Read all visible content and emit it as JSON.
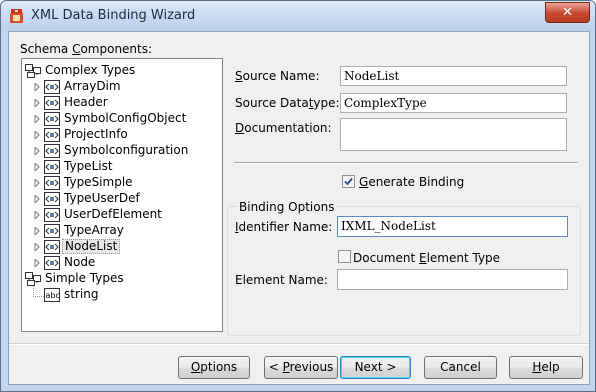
{
  "window": {
    "title": "XML Data Binding Wizard",
    "close_glyph": "✕"
  },
  "schema": {
    "label_pre": "Schema ",
    "label_mnemonic": "C",
    "label_post": "omponents:",
    "tree": [
      {
        "label": "Complex Types",
        "icon": "complex-types-folder-icon",
        "level": 0,
        "expander": false
      },
      {
        "label": "ArrayDim",
        "icon": "complex-type-icon",
        "level": 1,
        "expander": true
      },
      {
        "label": "Header",
        "icon": "complex-type-icon",
        "level": 1,
        "expander": true
      },
      {
        "label": "SymbolConfigObject",
        "icon": "complex-type-icon",
        "level": 1,
        "expander": true
      },
      {
        "label": "ProjectInfo",
        "icon": "complex-type-icon",
        "level": 1,
        "expander": true
      },
      {
        "label": "Symbolconfiguration",
        "icon": "complex-type-icon",
        "level": 1,
        "expander": true
      },
      {
        "label": "TypeList",
        "icon": "complex-type-icon",
        "level": 1,
        "expander": true
      },
      {
        "label": "TypeSimple",
        "icon": "complex-type-icon",
        "level": 1,
        "expander": true
      },
      {
        "label": "TypeUserDef",
        "icon": "complex-type-icon",
        "level": 1,
        "expander": true
      },
      {
        "label": "UserDefElement",
        "icon": "complex-type-icon",
        "level": 1,
        "expander": true
      },
      {
        "label": "TypeArray",
        "icon": "complex-type-icon",
        "level": 1,
        "expander": true
      },
      {
        "label": "NodeList",
        "icon": "complex-type-icon",
        "level": 1,
        "expander": true,
        "selected": true
      },
      {
        "label": "Node",
        "icon": "complex-type-icon",
        "level": 1,
        "expander": true
      },
      {
        "label": "Simple Types",
        "icon": "simple-types-folder-icon",
        "level": 0,
        "expander": false
      },
      {
        "label": "string",
        "icon": "abc-simple-type-icon",
        "level": 1,
        "expander": false,
        "abc": "abc"
      }
    ]
  },
  "details": {
    "source_name_label": {
      "pre": "",
      "m": "S",
      "post": "ource Name:"
    },
    "source_name_value": "NodeList",
    "source_datatype_label": {
      "pre": "Source Data",
      "m": "t",
      "post": "ype:"
    },
    "source_datatype_value": "ComplexType",
    "documentation_label": {
      "pre": "",
      "m": "D",
      "post": "ocumentation:"
    },
    "documentation_value": "",
    "generate_binding_label": {
      "pre": "",
      "m": "G",
      "post": "enerate Binding"
    },
    "generate_binding_checked": true
  },
  "binding_options": {
    "legend": "Binding Options",
    "identifier_label": {
      "pre": "",
      "m": "I",
      "post": "dentifier Name:"
    },
    "identifier_value": "IXML_NodeList",
    "doc_element_label": {
      "pre": "Document ",
      "m": "E",
      "post": "lement Type"
    },
    "doc_element_checked": false,
    "element_name_label": "Element Name:",
    "element_name_value": ""
  },
  "buttons": {
    "options": {
      "pre": "",
      "m": "O",
      "post": "ptions"
    },
    "previous": {
      "pre": "< ",
      "m": "P",
      "post": "revious"
    },
    "next": {
      "pre": "Next >",
      "m": "",
      "post": ""
    },
    "cancel": {
      "pre": "Cancel",
      "m": "",
      "post": ""
    },
    "help": {
      "pre": "",
      "m": "H",
      "post": "elp"
    }
  },
  "colors": {
    "selected_checkbox_mark": "#2c4a8a",
    "tree_icon_blue": "#5a7fc4"
  }
}
